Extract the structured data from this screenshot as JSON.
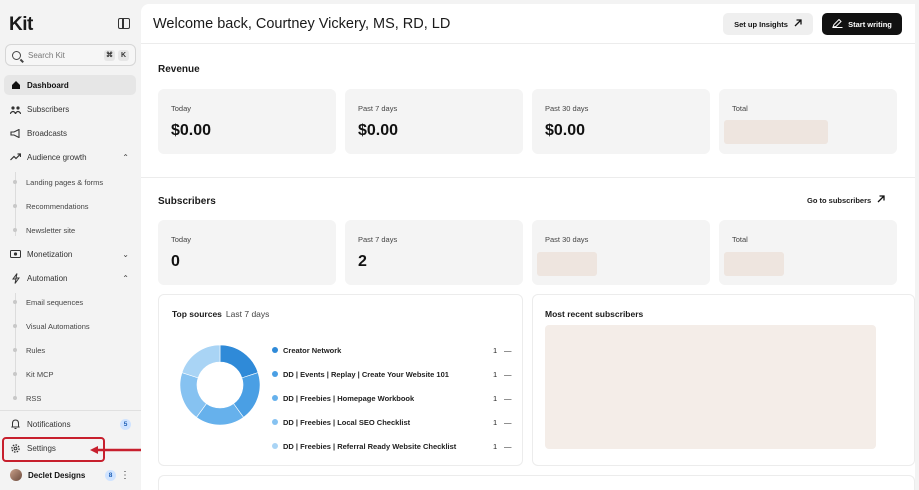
{
  "sidebar": {
    "logo": "Kit",
    "search_placeholder": "Search Kit",
    "shortcut": [
      "⌘",
      "K"
    ],
    "nav": {
      "dashboard": "Dashboard",
      "subscribers": "Subscribers",
      "broadcasts": "Broadcasts",
      "audience_growth": "Audience growth",
      "landing_pages": "Landing pages & forms",
      "recommendations": "Recommendations",
      "newsletter_site": "Newsletter site",
      "monetization": "Monetization",
      "automation": "Automation",
      "email_sequences": "Email sequences",
      "visual_automations": "Visual Automations",
      "rules": "Rules",
      "kit_mcp": "Kit MCP",
      "rss": "RSS",
      "notifications": "Notifications",
      "notifications_count": "5",
      "settings": "Settings",
      "account": "Declet Designs",
      "account_count": "8"
    }
  },
  "header": {
    "title": "Welcome back, Courtney Vickery, MS, RD, LD",
    "insights_label": "Set up Insights",
    "write_label": "Start writing"
  },
  "revenue": {
    "title": "Revenue",
    "cards": [
      {
        "label": "Today",
        "value": "$0.00"
      },
      {
        "label": "Past 7 days",
        "value": "$0.00"
      },
      {
        "label": "Past 30 days",
        "value": "$0.00"
      },
      {
        "label": "Total",
        "value": ""
      }
    ]
  },
  "subscribers": {
    "title": "Subscribers",
    "link": "Go to subscribers",
    "cards": [
      {
        "label": "Today",
        "value": "0"
      },
      {
        "label": "Past 7 days",
        "value": "2"
      },
      {
        "label": "Past 30 days",
        "value": ""
      },
      {
        "label": "Total",
        "value": ""
      }
    ]
  },
  "top_sources": {
    "title": "Top sources",
    "period": "Last 7 days",
    "items": [
      {
        "name": "Creator Network",
        "count": "1",
        "trend": "—",
        "color": "#2f8ad8"
      },
      {
        "name": "DD | Events | Replay | Create Your Website 101",
        "count": "1",
        "trend": "—",
        "color": "#4a9fe4"
      },
      {
        "name": "DD | Freebies | Homepage Workbook",
        "count": "1",
        "trend": "—",
        "color": "#66b1ec"
      },
      {
        "name": "DD | Freebies | Local SEO Checklist",
        "count": "1",
        "trend": "—",
        "color": "#86c2f1"
      },
      {
        "name": "DD | Freebies | Referral Ready Website Checklist",
        "count": "1",
        "trend": "—",
        "color": "#a9d4f5"
      }
    ]
  },
  "recent": {
    "title": "Most recent subscribers"
  }
}
